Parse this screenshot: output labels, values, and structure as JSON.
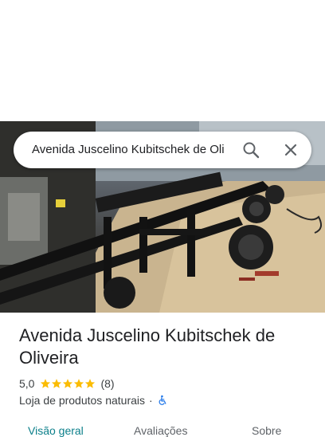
{
  "search": {
    "value": "Avenida Juscelino Kubitschek de Oli"
  },
  "place": {
    "name": "Avenida Juscelino Kubitschek de Oliveira",
    "rating": "5,0",
    "stars": 5,
    "review_count": "(8)",
    "category": "Loja de produtos naturais",
    "separator": "·"
  },
  "tabs": [
    {
      "label": "Visão geral"
    },
    {
      "label": "Avaliações"
    },
    {
      "label": "Sobre"
    }
  ],
  "colors": {
    "star": "#fbbc04",
    "accessibility": "#1a73e8",
    "active_tab": "#0b7f8a"
  },
  "icons": [
    "search-icon",
    "close-icon",
    "star-icon",
    "wheelchair-icon"
  ]
}
